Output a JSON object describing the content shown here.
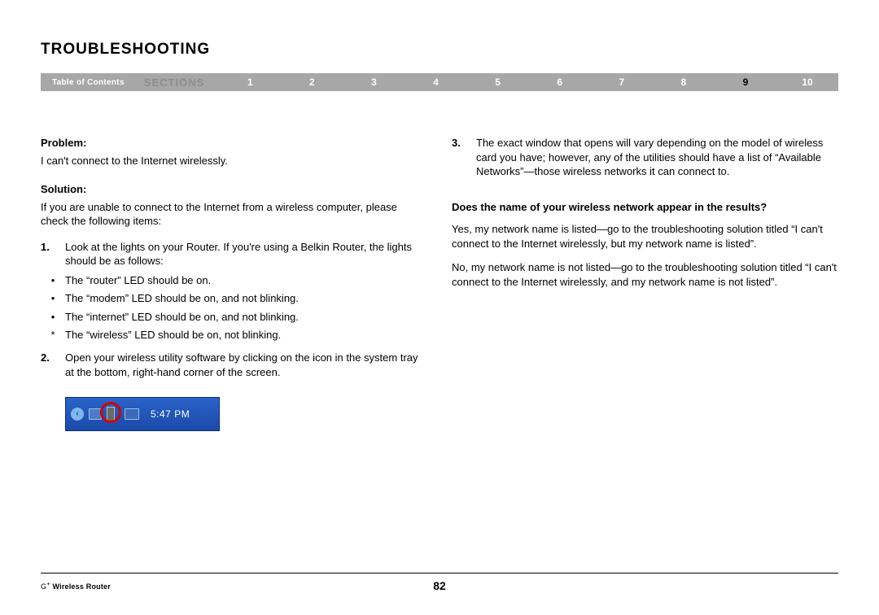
{
  "title": "TROUBLESHOOTING",
  "nav": {
    "toc": "Table of Contents",
    "sections_label": "SECTIONS",
    "items": [
      "1",
      "2",
      "3",
      "4",
      "5",
      "6",
      "7",
      "8",
      "9",
      "10"
    ],
    "active": "9"
  },
  "problem": {
    "label": "Problem:",
    "text": "I can't connect to the Internet wirelessly."
  },
  "solution": {
    "label": "Solution:",
    "intro": "If you are unable to connect to the Internet from a wireless computer, please check the following items:"
  },
  "left": {
    "item1_n": "1.",
    "item1_t": "Look at the lights on your Router. If you're using a Belkin Router, the lights should be as follows:",
    "b1": "The “router” LED should be on.",
    "b2": "The “modem” LED should be on, and not blinking.",
    "b3": "The “internet” LED should be on, and not blinking.",
    "b4": "The “wireless” LED should be on, not blinking.",
    "item2_n": "2.",
    "item2_t": "Open your wireless utility software by clicking on the icon in the system tray at the bottom, right-hand corner of the screen."
  },
  "right": {
    "item3_n": "3.",
    "item3_t": "The exact window that opens will vary depending on the model of wireless card you have; however, any of the utilities should have a list of “Available Networks”—those wireless networks it can connect to.",
    "question": "Does the name of your wireless network appear in the results?",
    "yes": "Yes, my network name is listed—go to the troubleshooting solution titled “I can't connect to the Internet wirelessly, but my network name is listed”.",
    "no": "No, my network name is not listed—go to the troubleshooting solution titled “I can't connect to the Internet wirelessly, and my network name is not listed”."
  },
  "systray": {
    "time": "5:47 PM"
  },
  "footer": {
    "product_prefix": "G",
    "product_sup": "+",
    "product_suffix": " Wireless Router",
    "page": "82"
  }
}
